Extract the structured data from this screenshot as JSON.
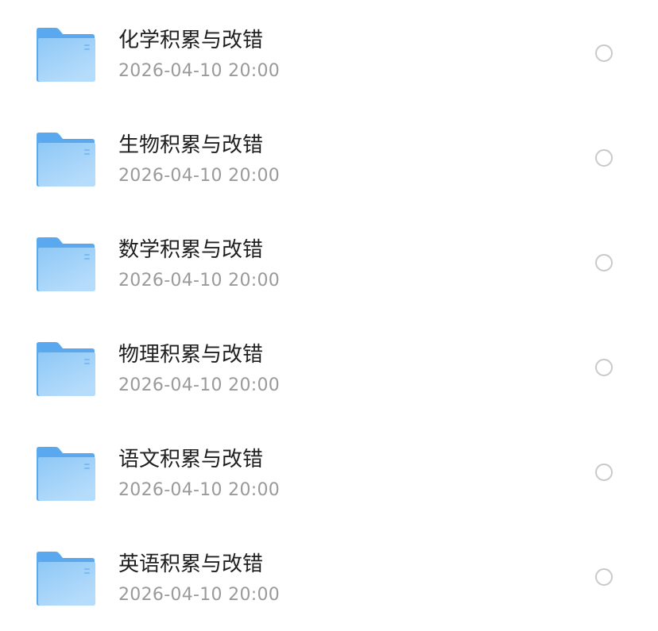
{
  "files": [
    {
      "name": "化学积累与改错",
      "date": "2026-04-10 20:00",
      "icon": "folder-icon"
    },
    {
      "name": "生物积累与改错",
      "date": "2026-04-10 20:00",
      "icon": "folder-icon"
    },
    {
      "name": "数学积累与改错",
      "date": "2026-04-10 20:00",
      "icon": "folder-icon"
    },
    {
      "name": "物理积累与改错",
      "date": "2026-04-10 20:00",
      "icon": "folder-icon"
    },
    {
      "name": "语文积累与改错",
      "date": "2026-04-10 20:00",
      "icon": "folder-icon"
    },
    {
      "name": "英语积累与改错",
      "date": "2026-04-10 20:00",
      "icon": "folder-icon"
    }
  ],
  "colors": {
    "folder_back": "#5aa8ee",
    "folder_front_top": "#8ec8f6",
    "folder_front_bottom": "#b3dbfb",
    "name_text": "#1f1f1f",
    "date_text": "#9a9a9a",
    "radio_border": "#c9c9c9"
  }
}
